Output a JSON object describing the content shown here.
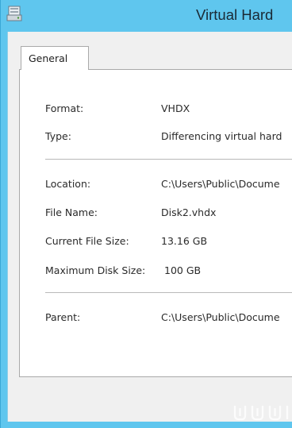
{
  "window": {
    "title": "Virtual Hard"
  },
  "tabs": [
    {
      "label": "General"
    }
  ],
  "fields": {
    "format": {
      "label": "Format:",
      "value": "VHDX"
    },
    "type": {
      "label": "Type:",
      "value": "Differencing virtual hard"
    },
    "location": {
      "label": "Location:",
      "value": "C:\\Users\\Public\\Docume"
    },
    "file_name": {
      "label": "File Name:",
      "value": "Disk2.vhdx"
    },
    "current_file_size": {
      "label": "Current File Size:",
      "value": "13.16 GB"
    },
    "maximum_disk_size": {
      "label": "Maximum Disk Size:",
      "value": "100 GB"
    },
    "parent": {
      "label": "Parent:",
      "value": "C:\\Users\\Public\\Docume"
    }
  },
  "icons": {
    "app": "disk-properties-icon"
  },
  "colors": {
    "frame": "#5fc6ee",
    "client": "#f0f0f0",
    "panel": "#ffffff"
  }
}
